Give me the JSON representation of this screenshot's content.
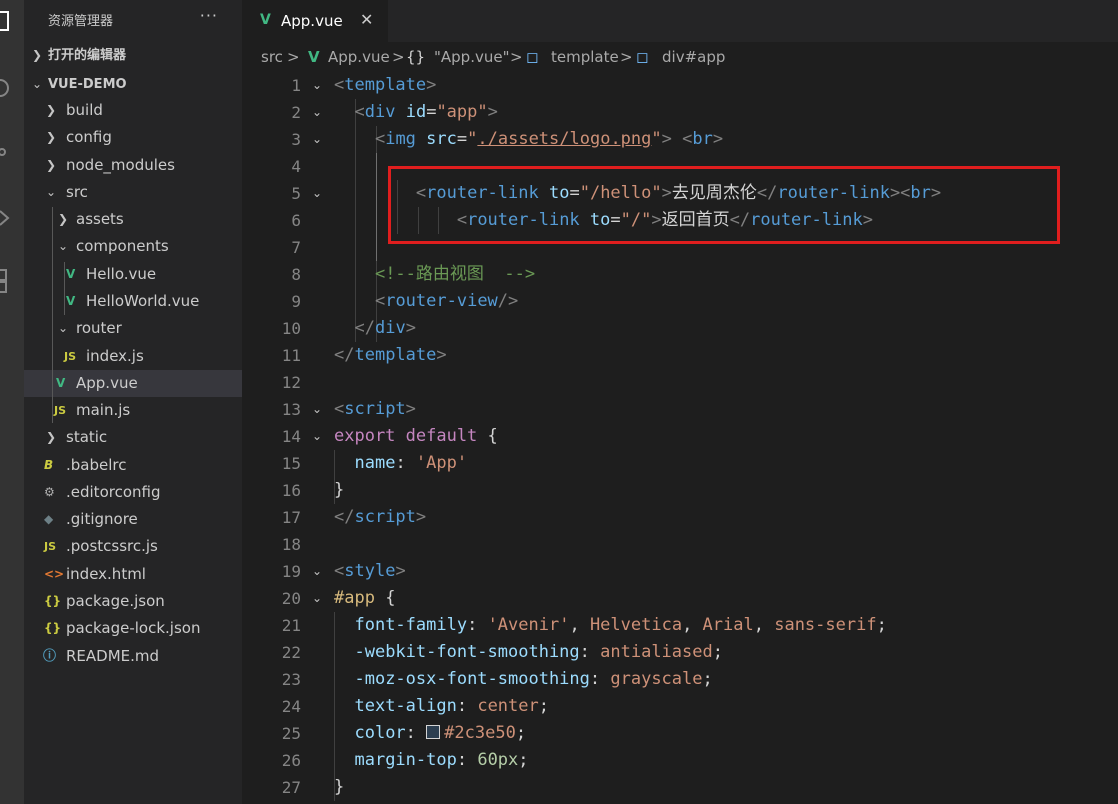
{
  "explorer": {
    "title": "资源管理器",
    "more": "···",
    "open_editors": "打开的编辑器",
    "project": "VUE-DEMO",
    "tree": {
      "build": "build",
      "config": "config",
      "node_modules": "node_modules",
      "src": "src",
      "assets": "assets",
      "components": "components",
      "hello_vue": "Hello.vue",
      "helloworld_vue": "HelloWorld.vue",
      "router": "router",
      "index_js": "index.js",
      "app_vue": "App.vue",
      "main_js": "main.js",
      "static": "static",
      "babelrc": ".babelrc",
      "editorconfig": ".editorconfig",
      "gitignore": ".gitignore",
      "postcssrc": ".postcssrc.js",
      "index_html": "index.html",
      "package_json": "package.json",
      "package_lock": "package-lock.json",
      "readme": "README.md"
    }
  },
  "tab": {
    "name": "App.vue",
    "close": "✕"
  },
  "breadcrumb": {
    "src": "src",
    "file": "App.vue",
    "braces": "{}",
    "component": "\"App.vue\"",
    "template": "template",
    "div": "div#app",
    "sep": ">"
  },
  "code": {
    "l1": "template",
    "l2_tag": "div",
    "l2_attr": "id",
    "l2_val": "\"app\"",
    "l3_tag": "img",
    "l3_attr": "src",
    "l3_val": "./assets/logo.png",
    "l3_br": "br",
    "l5_tag": "router-link",
    "l5_attr": "to",
    "l5_val": "\"/hello\"",
    "l5_text": "去见周杰伦",
    "l5_br": "br",
    "l6_tag": "router-link",
    "l6_attr": "to",
    "l6_val": "\"/\"",
    "l6_text": "返回首页",
    "l8": "<!--路由视图  -->",
    "l9": "router-view",
    "l10": "div",
    "l11": "template",
    "l13": "script",
    "l14_kw": "export default",
    "l15_key": "name",
    "l15_val": "'App'",
    "l17": "script",
    "l19": "style",
    "l20": "#app",
    "l21_p": "font-family",
    "l21_v1": "'Avenir'",
    "l21_v2": "Helvetica",
    "l21_v3": "Arial",
    "l21_v4": "sans-serif",
    "l22_p": "-webkit-font-smoothing",
    "l22_v": "antialiased",
    "l23_p": "-moz-osx-font-smoothing",
    "l23_v": "grayscale",
    "l24_p": "text-align",
    "l24_v": "center",
    "l25_p": "color",
    "l25_v": "#2c3e50",
    "l26_p": "margin-top",
    "l26_v": "60px"
  },
  "line_numbers": [
    "1",
    "2",
    "3",
    "4",
    "5",
    "6",
    "7",
    "8",
    "9",
    "10",
    "11",
    "12",
    "13",
    "14",
    "15",
    "16",
    "17",
    "18",
    "19",
    "20",
    "21",
    "22",
    "23",
    "24",
    "25",
    "26",
    "27"
  ]
}
